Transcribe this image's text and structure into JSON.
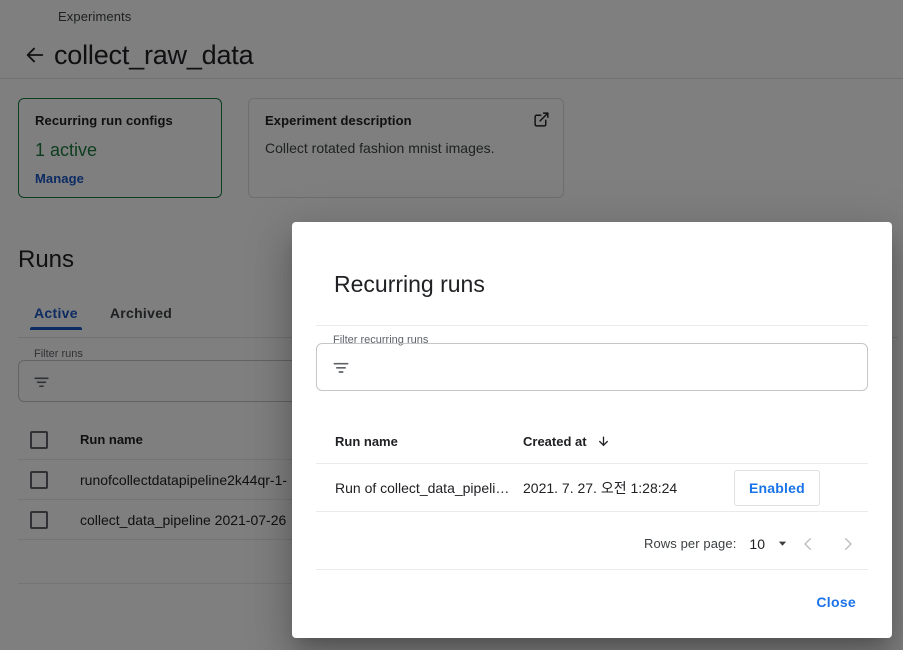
{
  "breadcrumb": {
    "label": "Experiments"
  },
  "header": {
    "back_icon": "arrow-left-icon",
    "title": "collect_raw_data"
  },
  "cards": {
    "recurring": {
      "title": "Recurring run configs",
      "metric": "1 active",
      "link": "Manage",
      "border_color": "#1a7a3c",
      "metric_color": "#1a7a3c",
      "link_color": "#1a56c4"
    },
    "description": {
      "title": "Experiment description",
      "text": "Collect rotated fashion mnist images.",
      "icon": "open-in-new-icon"
    }
  },
  "runs_section": {
    "heading": "Runs",
    "tabs": [
      {
        "label": "Active",
        "selected": true
      },
      {
        "label": "Archived",
        "selected": false
      }
    ],
    "filter": {
      "legend": "Filter runs",
      "value": "",
      "placeholder": "",
      "icon": "filter-icon"
    },
    "table": {
      "columns": [
        "Run name"
      ],
      "rows": [
        {
          "name": "runofcollectdatapipeline2k44qr-1-"
        },
        {
          "name": "collect_data_pipeline 2021-07-26"
        }
      ]
    }
  },
  "dialog": {
    "title": "Recurring runs",
    "filter": {
      "legend": "Filter recurring runs",
      "value": "",
      "placeholder": "",
      "icon": "filter-icon"
    },
    "table": {
      "columns": [
        {
          "label": "Run name",
          "sorted": false
        },
        {
          "label": "Created at",
          "sorted": true,
          "sort_icon": "arrow-down-icon"
        },
        {
          "label": "",
          "sorted": false
        }
      ],
      "rows": [
        {
          "name": "Run of collect_data_pipeli…",
          "created_at": "2021. 7. 27. 오전 1:28:24",
          "status": "Enabled"
        }
      ]
    },
    "paginator": {
      "rows_per_page_label": "Rows per page:",
      "rows_per_page_value": "10",
      "caret_icon": "chevron-down-icon",
      "prev_icon": "chevron-left-icon",
      "next_icon": "chevron-right-icon"
    },
    "close_button": "Close",
    "accent_color": "#1a73e8"
  }
}
